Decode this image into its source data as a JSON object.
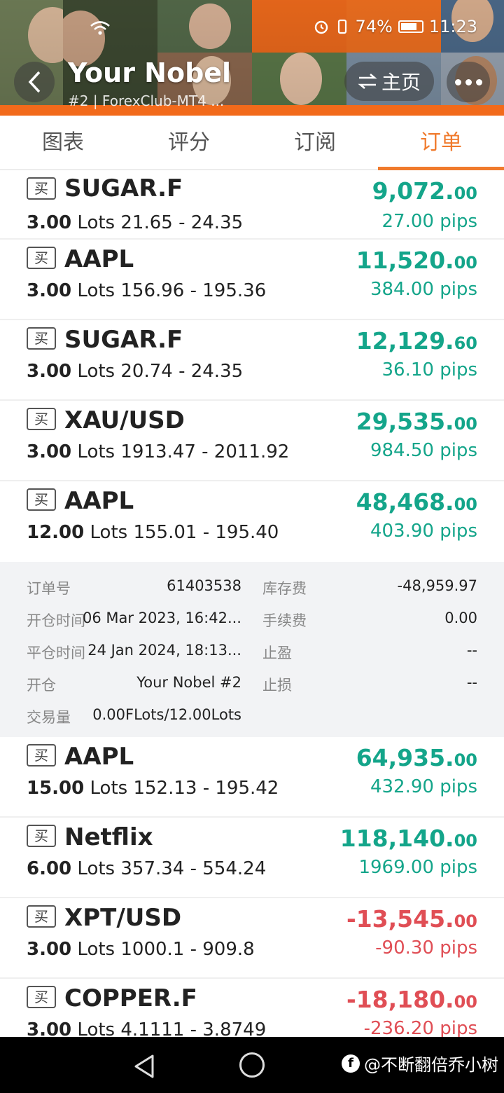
{
  "colors": {
    "accent": "#f07a2c",
    "profit": "#14a58a",
    "loss": "#e04e55",
    "detail_bg": "#f2f3f5"
  },
  "status_bar": {
    "battery": "74%",
    "time": "11:23"
  },
  "header": {
    "title": "Your Nobel",
    "subtitle": "#2 | ForexClub-MT4 ...",
    "home_label": "主页",
    "home_icon": "swap-arrows-icon",
    "back_icon": "chevron-left-icon",
    "more_icon": "more-dots-icon"
  },
  "tabs": [
    {
      "label": "图表",
      "active": false
    },
    {
      "label": "评分",
      "active": false
    },
    {
      "label": "订阅",
      "active": false
    },
    {
      "label": "订单",
      "active": true
    }
  ],
  "orders": [
    {
      "side": "买",
      "symbol": "SUGAR.F",
      "lots": "3.00",
      "lots_unit": "Lots",
      "range": "21.65 - 24.35",
      "profit_main": "9,072.",
      "profit_cents": "00",
      "pips": "27.00 pips",
      "negative": false
    },
    {
      "side": "买",
      "symbol": "AAPL",
      "lots": "3.00",
      "lots_unit": "Lots",
      "range": "156.96 - 195.36",
      "profit_main": "11,520.",
      "profit_cents": "00",
      "pips": "384.00 pips",
      "negative": false
    },
    {
      "side": "买",
      "symbol": "SUGAR.F",
      "lots": "3.00",
      "lots_unit": "Lots",
      "range": "20.74 - 24.35",
      "profit_main": "12,129.",
      "profit_cents": "60",
      "pips": "36.10 pips",
      "negative": false
    },
    {
      "side": "买",
      "symbol": "XAU/USD",
      "lots": "3.00",
      "lots_unit": "Lots",
      "range": "1913.47 - 2011.92",
      "profit_main": "29,535.",
      "profit_cents": "00",
      "pips": "984.50 pips",
      "negative": false
    },
    {
      "side": "买",
      "symbol": "AAPL",
      "lots": "12.00",
      "lots_unit": "Lots",
      "range": "155.01 - 195.40",
      "profit_main": "48,468.",
      "profit_cents": "00",
      "pips": "403.90 pips",
      "negative": false
    }
  ],
  "detail": {
    "order_no_label": "订单号",
    "order_no": "61403538",
    "swap_label": "库存费",
    "swap": "-48,959.97",
    "open_time_label": "开仓时间",
    "open_time": "06 Mar 2023, 16:42...",
    "commission_label": "手续费",
    "commission": "0.00",
    "close_time_label": "平仓时间",
    "close_time": "24 Jan 2024, 18:13...",
    "tp_label": "止盈",
    "tp": "--",
    "open_by_label": "开仓",
    "open_by": "Your Nobel  #2",
    "sl_label": "止损",
    "sl": "--",
    "volume_label": "交易量",
    "volume": "0.00FLots/12.00Lots"
  },
  "orders_after": [
    {
      "side": "买",
      "symbol": "AAPL",
      "lots": "15.00",
      "lots_unit": "Lots",
      "range": "152.13 - 195.42",
      "profit_main": "64,935.",
      "profit_cents": "00",
      "pips": "432.90 pips",
      "negative": false
    },
    {
      "side": "买",
      "symbol": "Netflix",
      "lots": "6.00",
      "lots_unit": "Lots",
      "range": "357.34 - 554.24",
      "profit_main": "118,140.",
      "profit_cents": "00",
      "pips": "1969.00 pips",
      "negative": false
    },
    {
      "side": "买",
      "symbol": "XPT/USD",
      "lots": "3.00",
      "lots_unit": "Lots",
      "range": "1000.1 - 909.8",
      "profit_main": "-13,545.",
      "profit_cents": "00",
      "pips": "-90.30 pips",
      "negative": true
    },
    {
      "side": "买",
      "symbol": "COPPER.F",
      "lots": "3.00",
      "lots_unit": "Lots",
      "range": "4.1111 - 3.8749",
      "profit_main": "-18,180.",
      "profit_cents": "00",
      "pips": "-236.20 pips",
      "negative": true
    }
  ],
  "watermark": {
    "logo": "f",
    "text": "@不断翻倍乔小树"
  }
}
